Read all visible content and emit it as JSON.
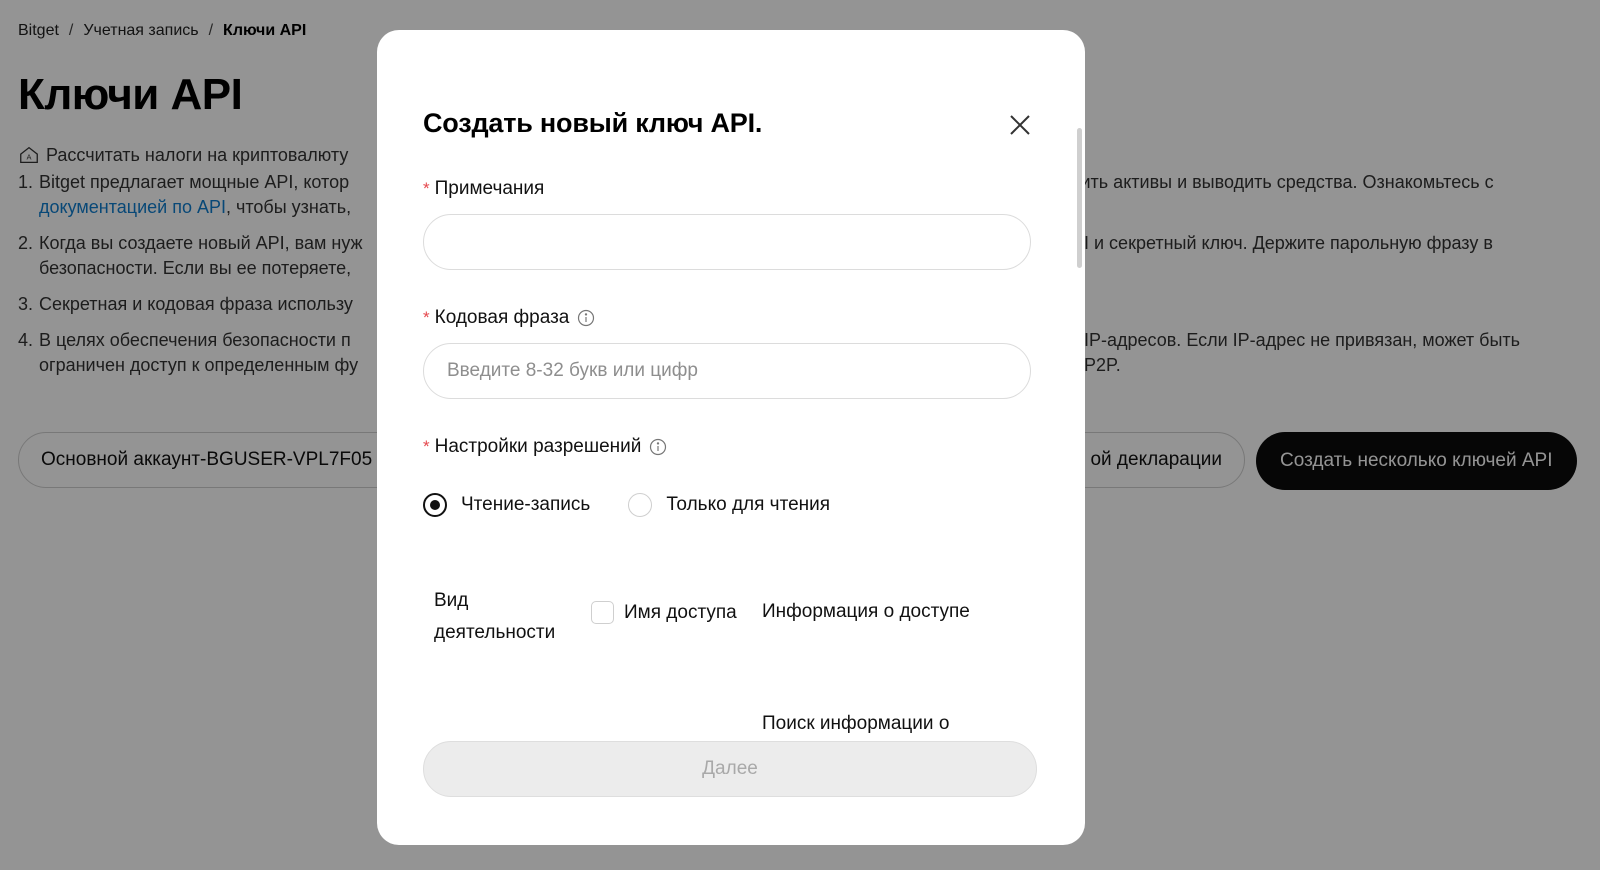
{
  "breadcrumb": {
    "root": "Bitget",
    "account": "Учетная запись",
    "current": "Ключи API",
    "separator": "/"
  },
  "page": {
    "title": "Ключи API",
    "tax_link": "Рассчитать налоги на криптовалюту",
    "notes": [
      {
        "num": "1.",
        "left_line1": "Bitget предлагает мощные API, котор",
        "link": "документацией по API",
        "left_line2_rest": ", чтобы узнать,",
        "right_line1": "дить активы и выводить средства. Ознакомьтесь с"
      },
      {
        "num": "2.",
        "left_line1": "Когда вы создаете новый API, вам нуж",
        "left_line2": "безопасности. Если вы ее потеряете,",
        "right_line1": "I и секретный ключ. Держите парольную фразу в"
      },
      {
        "num": "3.",
        "left_line1": "Секретная и кодовая фраза использу"
      },
      {
        "num": "4.",
        "left_line1": "В целях обеспечения безопасности п",
        "left_line2": "ограничен доступ к определенным фу",
        "right_line1": "IP-адресов. Если IP-адрес не привязан, может быть",
        "right_line2": "P2P."
      }
    ],
    "account_selector": "Основной аккаунт-BGUSER-VPL7F05",
    "declaration_button": "ой декларации",
    "create_multi_button": "Создать несколько ключей API"
  },
  "modal": {
    "title": "Создать новый ключ API.",
    "notes_label": "Примечания",
    "notes_value": "",
    "passphrase_label": "Кодовая фраза",
    "passphrase_placeholder": "Введите 8-32 букв или цифр",
    "permissions_label": "Настройки разрешений",
    "permission_options": [
      "Чтение-запись",
      "Только для чтения"
    ],
    "selected_permission": "Чтение-запись",
    "table_headers": {
      "activity": "Вид деятельности",
      "access_name": "Имя доступа",
      "access_info": "Информация о доступе"
    },
    "row_partial_text": "Поиск информации о",
    "next_button": "Далее",
    "required_mark": "*"
  }
}
